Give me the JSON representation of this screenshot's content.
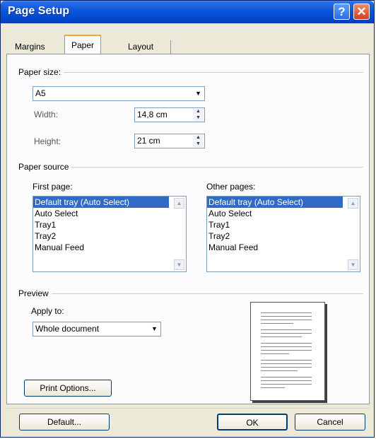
{
  "window": {
    "title": "Page Setup",
    "help_glyph": "?",
    "close_glyph": "✕"
  },
  "tabs": [
    {
      "label": "Margins",
      "active": false
    },
    {
      "label": "Paper",
      "active": true
    },
    {
      "label": "Layout",
      "active": false
    }
  ],
  "paper_size": {
    "group_label": "Paper size:",
    "selected": "A5",
    "width_label": "Width:",
    "width_value": "14,8 cm",
    "height_label": "Height:",
    "height_value": "21 cm"
  },
  "paper_source": {
    "group_label": "Paper source",
    "first_page_label": "First page:",
    "other_pages_label": "Other pages:",
    "first_page_items": [
      "Default tray (Auto Select)",
      "Auto Select",
      "Tray1",
      "Tray2",
      "Manual Feed"
    ],
    "other_pages_items": [
      "Default tray (Auto Select)",
      "Auto Select",
      "Tray1",
      "Tray2",
      "Manual Feed"
    ],
    "selected_index": 0
  },
  "preview": {
    "group_label": "Preview",
    "apply_to_label": "Apply to:",
    "apply_to_value": "Whole document"
  },
  "buttons": {
    "print_options": "Print Options...",
    "default": "Default...",
    "ok": "OK",
    "cancel": "Cancel"
  },
  "glyphs": {
    "dropdown": "▼",
    "spin_up": "▲",
    "spin_down": "▼",
    "scroll_up": "▲",
    "scroll_down": "▼"
  },
  "colors": {
    "title_bar": "#0b56d8",
    "selection": "#316ac5",
    "dialog_bg": "#ece9d8",
    "panel_bg": "#fcfcfe",
    "tab_highlight": "#f2a531"
  }
}
